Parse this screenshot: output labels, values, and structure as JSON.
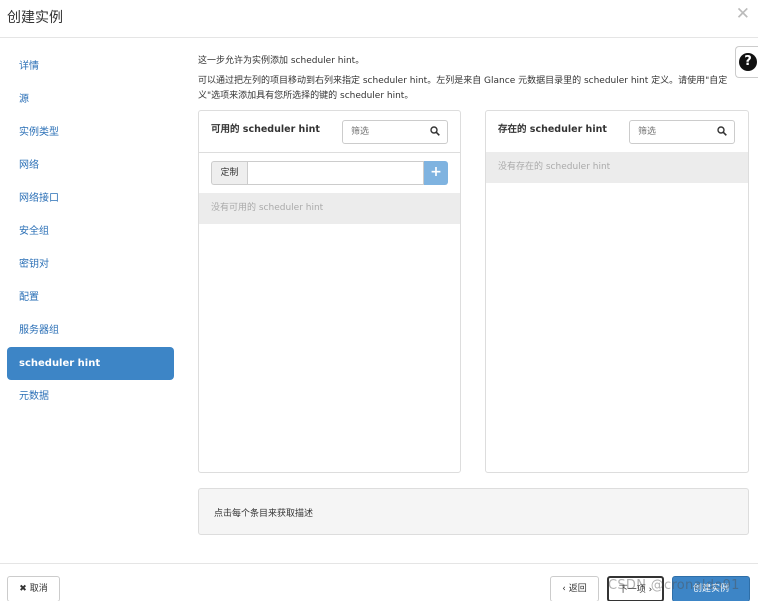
{
  "modal": {
    "title": "创建实例",
    "close_icon": "close-icon",
    "help_icon": "question-circle-icon"
  },
  "nav": {
    "items": [
      {
        "label": "详情"
      },
      {
        "label": "源"
      },
      {
        "label": "实例类型"
      },
      {
        "label": "网络"
      },
      {
        "label": "网络接口"
      },
      {
        "label": "安全组"
      },
      {
        "label": "密钥对"
      },
      {
        "label": "配置"
      },
      {
        "label": "服务器组"
      },
      {
        "label": "scheduler hint",
        "active": true
      },
      {
        "label": "元数据"
      }
    ]
  },
  "intro": {
    "line1": "这一步允许为实例添加 scheduler hint。",
    "line2": "可以通过把左列的项目移动到右列来指定 scheduler hint。左列是来自 Glance 元数据目录里的 scheduler hint 定义。请使用\"自定义\"选项来添加具有您所选择的键的 scheduler hint。"
  },
  "available": {
    "title": "可用的 scheduler hint",
    "filter_placeholder": "筛选",
    "custom_label": "定制",
    "empty_text": "没有可用的 scheduler hint"
  },
  "existing": {
    "title": "存在的 scheduler hint",
    "filter_placeholder": "筛选",
    "empty_text": "没有存在的 scheduler hint"
  },
  "description": {
    "text": "点击每个条目来获取描述"
  },
  "footer": {
    "cancel_label": "✖ 取消",
    "back_label": "‹ 返回",
    "next_label": "下一项 ›",
    "create_label": "创建实例",
    "watermark": "CSDN @cronaldo91"
  },
  "colors": {
    "accent": "#3d85c6",
    "link": "#2a6fb6"
  }
}
